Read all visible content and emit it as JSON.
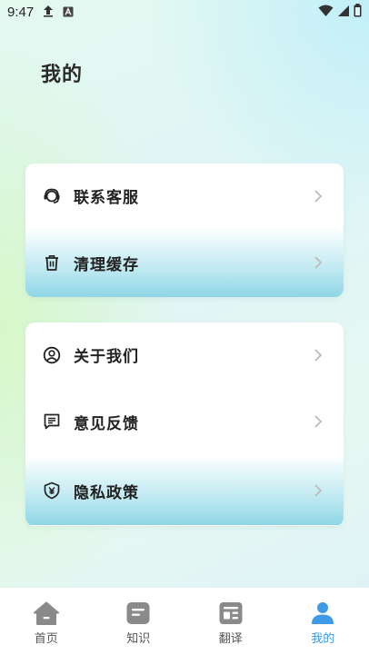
{
  "status_bar": {
    "time": "9:47",
    "icons": [
      "upload-icon",
      "app-a-icon",
      "wifi-icon",
      "signal-icon",
      "battery-icon"
    ]
  },
  "page": {
    "title": "我的"
  },
  "card_one": {
    "items": [
      {
        "label": "联系客服",
        "icon": "headset-icon"
      },
      {
        "label": "清理缓存",
        "icon": "trash-icon"
      }
    ]
  },
  "card_two": {
    "items": [
      {
        "label": "关于我们",
        "icon": "user-circle-icon"
      },
      {
        "label": "意见反馈",
        "icon": "feedback-icon"
      },
      {
        "label": "隐私政策",
        "icon": "shield-icon"
      }
    ]
  },
  "tab_bar": {
    "tabs": [
      {
        "label": "首页",
        "icon": "home-icon"
      },
      {
        "label": "知识",
        "icon": "knowledge-icon"
      },
      {
        "label": "翻译",
        "icon": "translate-icon"
      },
      {
        "label": "我的",
        "icon": "profile-icon",
        "active": true
      }
    ]
  },
  "colors": {
    "accent": "#3f9be6",
    "inactive_icon": "#8a8a8a",
    "highlight": "#8fd6e6"
  }
}
